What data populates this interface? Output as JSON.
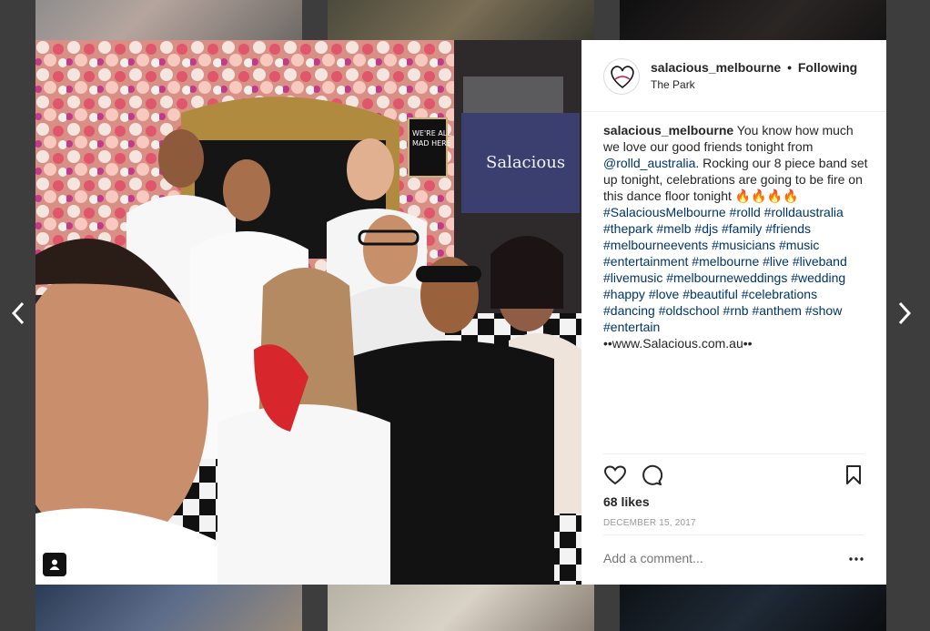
{
  "post": {
    "username": "salacious_melbourne",
    "separator": "•",
    "follow_label": "Following",
    "location": "The Park",
    "caption": {
      "username": "salacious_melbourne",
      "text_1": " You know how much we love our good friends tonight from ",
      "mention": "@rolld_australia",
      "text_2": ". Rocking our 8 piece band set up tonight, celebrations are going to be fire on this dance floor tonight 🔥🔥🔥🔥",
      "hashtags": [
        "#SalaciousMelbourne",
        "#rolld",
        "#rolldaustralia",
        "#thepark",
        "#melb",
        "#djs",
        "#family",
        "#friends",
        "#melbourneevents",
        "#musicians",
        "#music",
        "#entertainment",
        "#melbourne",
        "#live",
        "#liveband",
        "#livemusic",
        "#melbourneweddings",
        "#wedding",
        "#happy",
        "#love",
        "#beautiful",
        "#celebrations",
        "#dancing",
        "#oldschool",
        "#rnb",
        "#anthem",
        "#show",
        "#entertain"
      ],
      "website": "••www.Salacious.com.au••"
    },
    "likes": "68 likes",
    "date": "DECEMBER 15, 2017",
    "comment_placeholder": "Add a comment...",
    "photo_sign_text": [
      "WE'RE ALL",
      "MAD HERE"
    ],
    "banner_text": "Salacious"
  },
  "icons": {
    "prev": "chevron-left-icon",
    "next": "chevron-right-icon",
    "like": "heart-icon",
    "comment": "comment-icon",
    "save": "bookmark-icon",
    "more": "more-options-icon",
    "tag": "user-tag-icon"
  },
  "colors": {
    "link": "#003569",
    "text": "#262626",
    "muted": "#999999"
  }
}
